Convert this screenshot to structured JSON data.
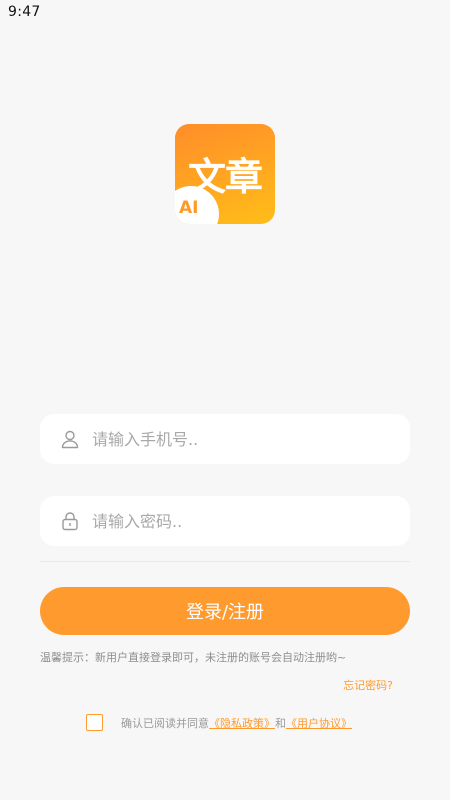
{
  "status": {
    "time": "9:47"
  },
  "logo": {
    "text": "文章",
    "badge": "AI"
  },
  "phone": {
    "placeholder": "请输入手机号..",
    "icon": "user-icon"
  },
  "password": {
    "placeholder": "请输入密码..",
    "icon": "lock-icon"
  },
  "login": {
    "label": "登录/注册"
  },
  "tip": {
    "text": "温馨提示：新用户直接登录即可，未注册的账号会自动注册哟~"
  },
  "forgot": {
    "label": "忘记密码?"
  },
  "agreement": {
    "prefix": "确认已阅读并同意",
    "privacy": "《隐私政策》",
    "and": "和",
    "terms": "《用户协议》"
  },
  "colors": {
    "accent": "#ff9a2e",
    "background": "#f7f7f7"
  }
}
